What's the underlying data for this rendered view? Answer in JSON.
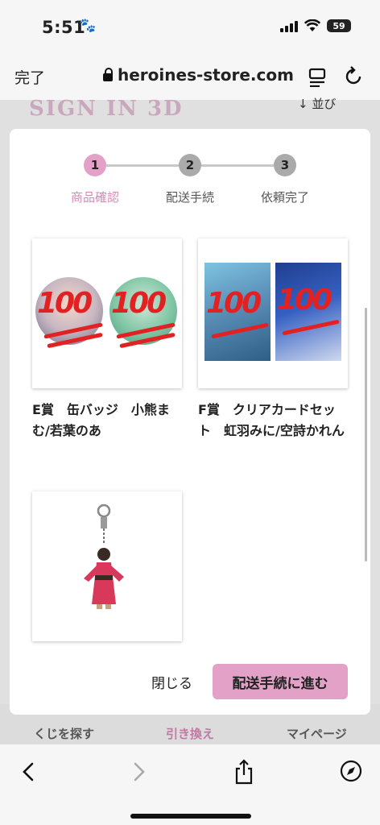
{
  "status_bar": {
    "time": "5:51",
    "battery_level": "59"
  },
  "browser": {
    "done_label": "完了",
    "url": "heroines-store.com"
  },
  "background_page": {
    "logo": "SIGN IN 3D",
    "sort": "↓ 並び",
    "tabs": [
      {
        "label": "くじを探す",
        "active": false
      },
      {
        "label": "引き換え",
        "active": true
      },
      {
        "label": "マイページ",
        "active": false
      }
    ]
  },
  "stepper": {
    "steps": [
      {
        "number": "1",
        "label": "商品確認",
        "active": true
      },
      {
        "number": "2",
        "label": "配送手続",
        "active": false
      },
      {
        "number": "3",
        "label": "依頼完了",
        "active": false
      }
    ]
  },
  "items": [
    {
      "title": "E賞　缶バッジ　小熊まむ/若葉のあ",
      "image": "can-badges-censored"
    },
    {
      "title": "F賞　クリアカードセット　虹羽みに/空詩かれん",
      "image": "clear-cards-censored"
    },
    {
      "title": "",
      "image": "acrylic-keychain-kimono"
    }
  ],
  "footer": {
    "close_label": "閉じる",
    "proceed_label": "配送手続に進む"
  },
  "colors": {
    "accent": "#e3a1c7",
    "accent_text": "#d58ab8",
    "overlay": "#e0e0e0",
    "emoji_red": "#e22222"
  }
}
